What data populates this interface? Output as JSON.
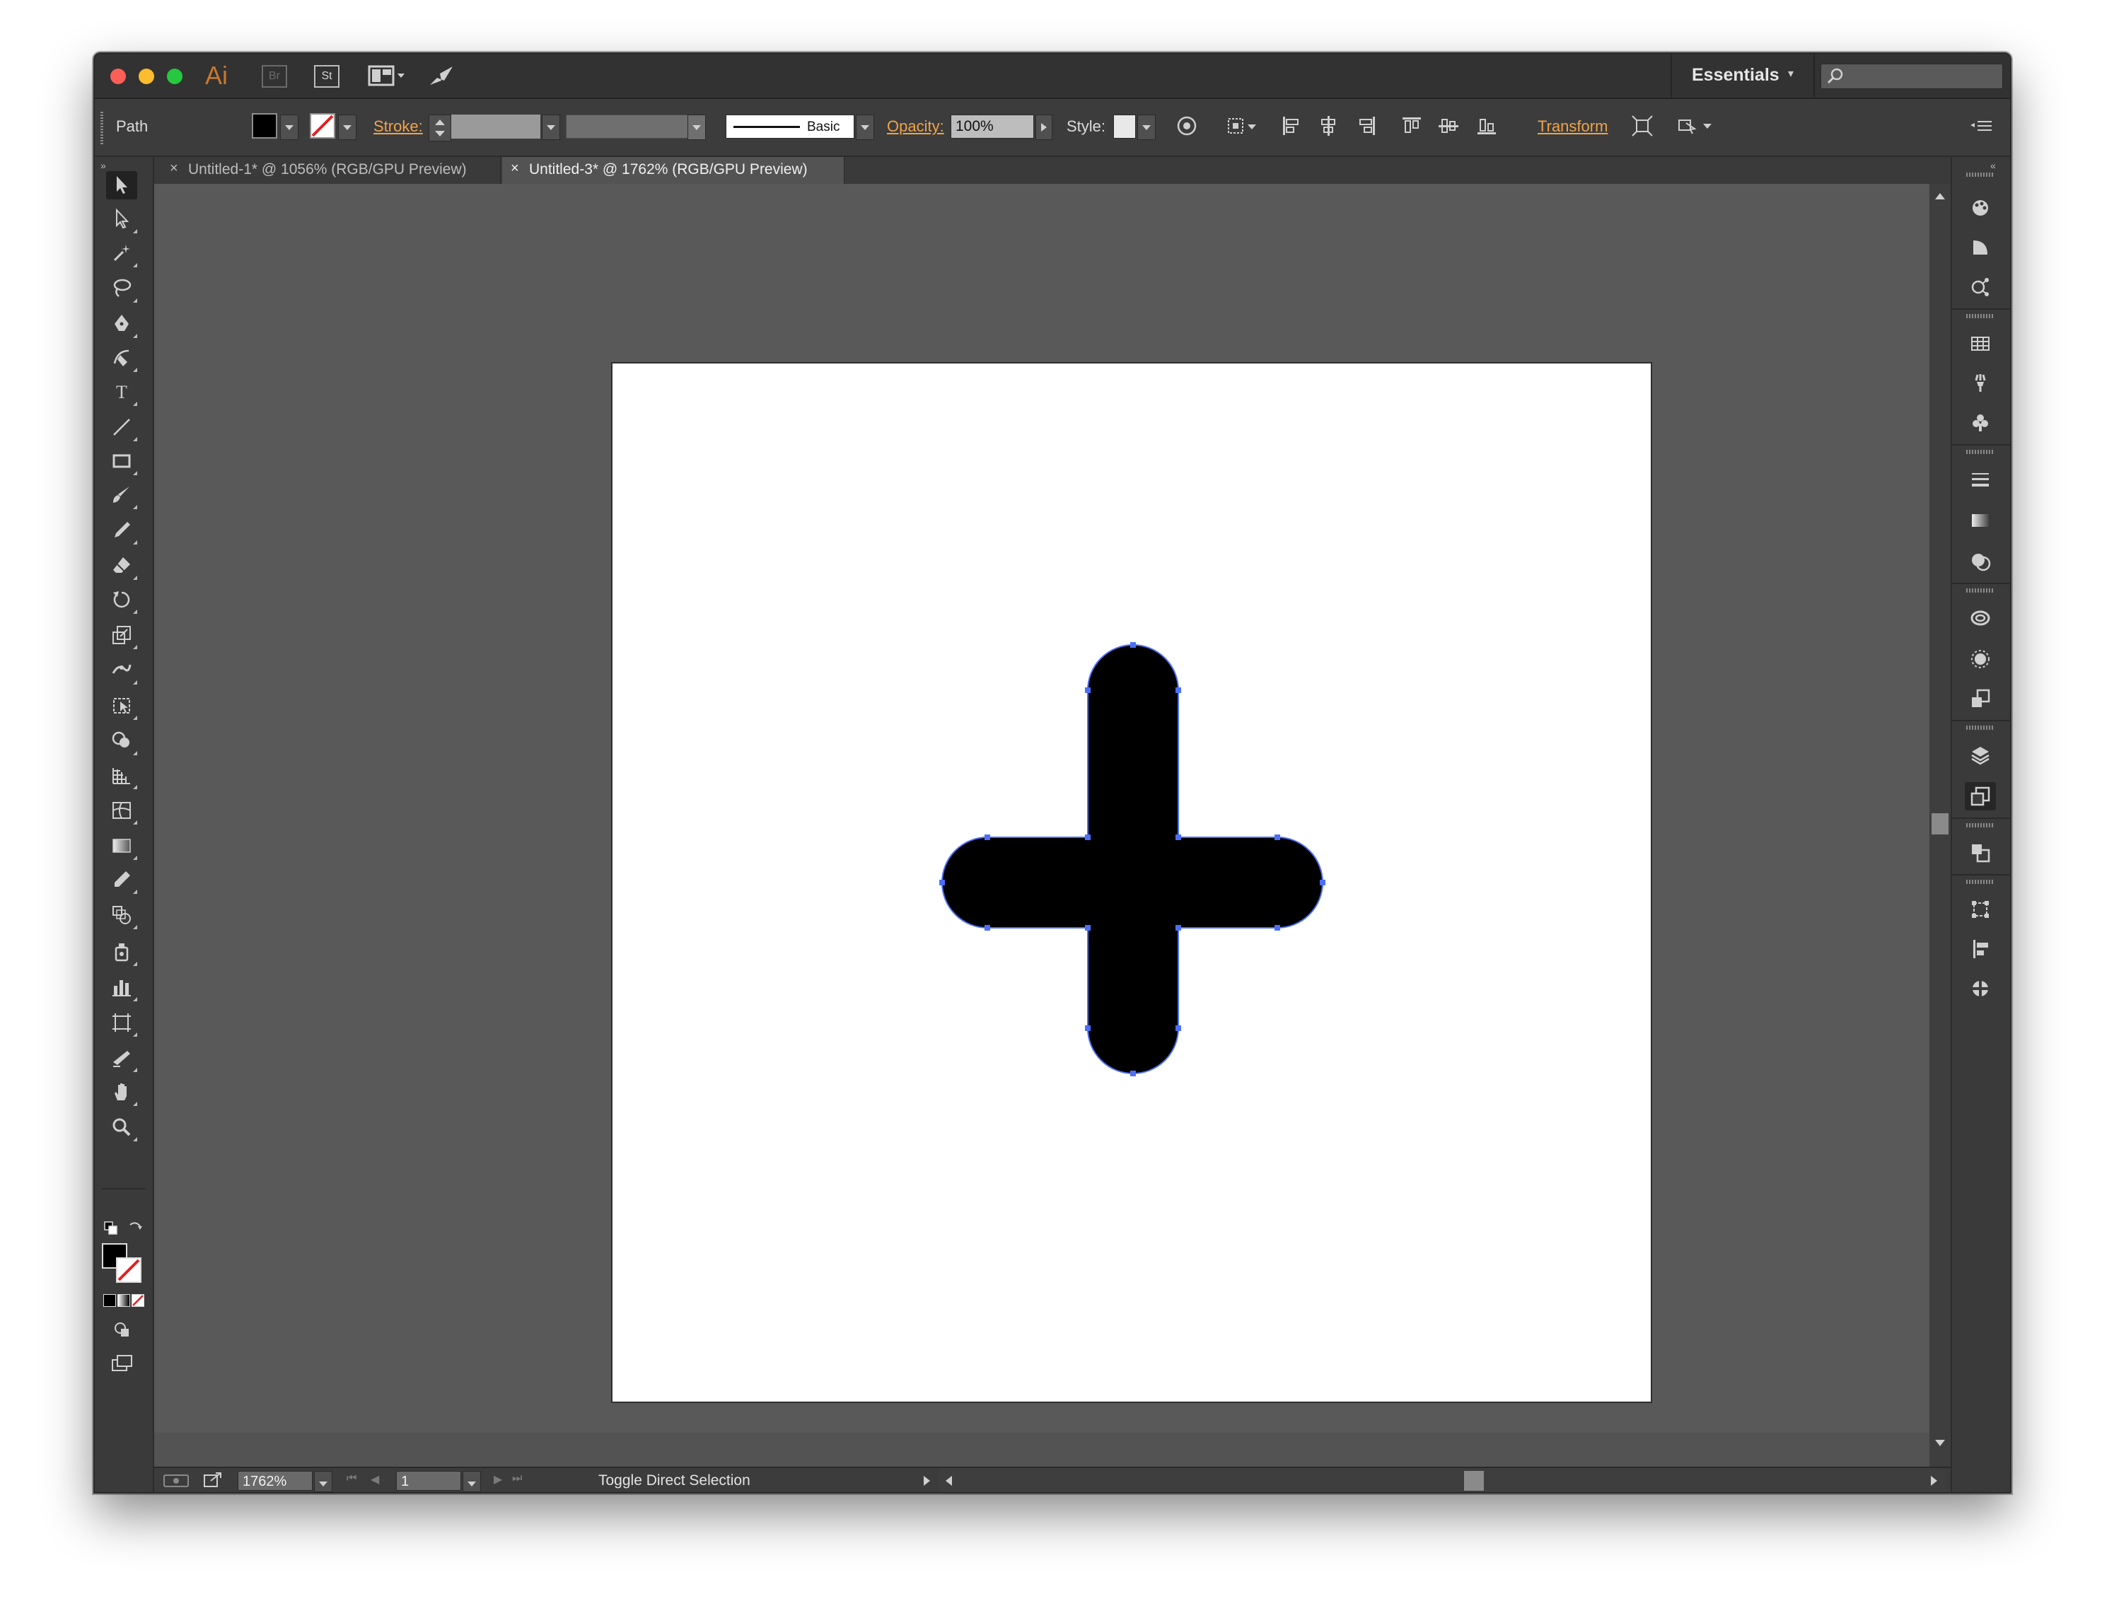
{
  "window": {
    "app_logo": "Ai",
    "bridge_label": "Br",
    "stock_label": "St",
    "workspace": "Essentials",
    "search_placeholder": ""
  },
  "control_bar": {
    "selection_type": "Path",
    "stroke_label": "Stroke:",
    "stroke_weight": "",
    "stroke_profile": "",
    "brush_label": "Basic",
    "opacity_label": "Opacity:",
    "opacity_value": "100%",
    "style_label": "Style:",
    "transform_label": "Transform"
  },
  "tabs": [
    {
      "label": "Untitled-1* @ 1056% (RGB/GPU Preview)",
      "active": false
    },
    {
      "label": "Untitled-3* @ 1762% (RGB/GPU Preview)",
      "active": true
    }
  ],
  "status_bar": {
    "zoom": "1762%",
    "artboard_number": "1",
    "status_text": "Toggle Direct Selection"
  },
  "colors": {
    "fill": "#000000",
    "stroke": "none",
    "anchor": "#4d6ff5",
    "accent": "#f0a44a"
  },
  "tools": [
    "selection-tool",
    "direct-selection-tool",
    "magic-wand-tool",
    "lasso-tool",
    "pen-tool",
    "curvature-tool",
    "type-tool",
    "line-segment-tool",
    "rectangle-tool",
    "paintbrush-tool",
    "pencil-tool",
    "eraser-tool",
    "rotate-tool",
    "scale-tool",
    "width-tool",
    "free-transform-tool",
    "shape-builder-tool",
    "perspective-grid-tool",
    "mesh-tool",
    "gradient-tool",
    "eyedropper-tool",
    "blend-tool",
    "symbol-sprayer-tool",
    "column-graph-tool",
    "artboard-tool",
    "slice-tool",
    "hand-tool",
    "zoom-tool"
  ],
  "panels": [
    "color-panel",
    "color-guide-panel",
    "kuler-panel",
    "swatches-panel",
    "brushes-panel",
    "symbols-panel",
    "stroke-panel",
    "gradient-panel",
    "transparency-panel",
    "libraries-panel",
    "appearance-panel",
    "graphic-styles-panel",
    "layers-panel",
    "artboards-panel",
    "links-panel",
    "transform-panel",
    "align-panel",
    "pathfinder-panel"
  ]
}
